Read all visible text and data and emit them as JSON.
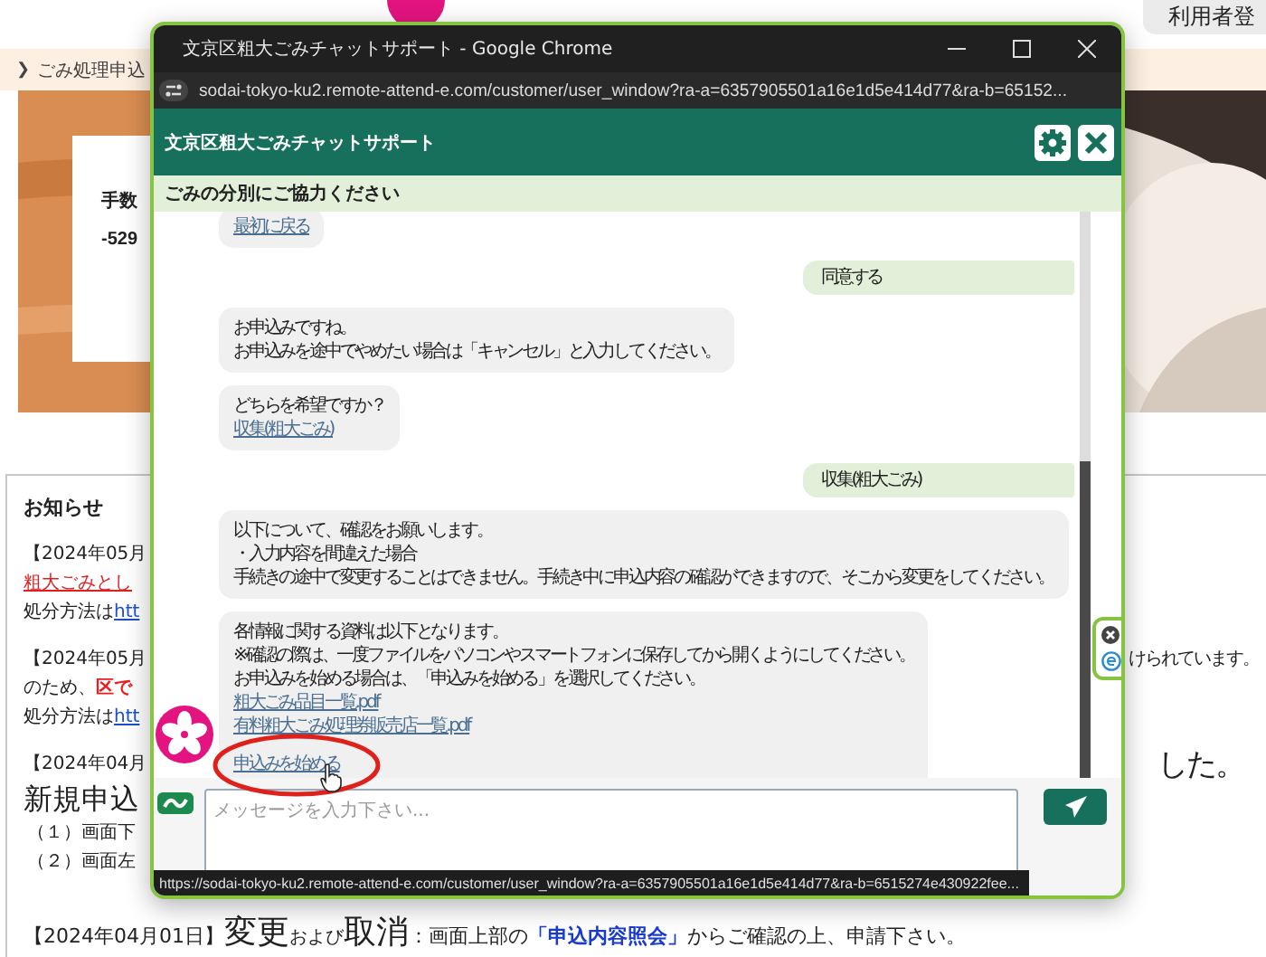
{
  "site": {
    "top_button": "利用者登",
    "breadcrumb": {
      "chevron": "❯",
      "label": "ごみ処理申込"
    },
    "hero_card": {
      "title": "手数",
      "code": "-529"
    }
  },
  "notices": {
    "title": "お知らせ",
    "rows": [
      {
        "kind": "date",
        "text": "【2024年05月"
      },
      {
        "kind": "redlink",
        "text": "粗大ごみとし"
      },
      {
        "kind": "method",
        "text": "処分方法は",
        "link": "htt"
      },
      {
        "kind": "date",
        "text": "【2024年05月",
        "right": "けられています。"
      },
      {
        "kind": "warning",
        "text": "のため、**区で**"
      },
      {
        "kind": "method",
        "text": "処分方法は",
        "link": "htt"
      },
      {
        "kind": "date",
        "text": "【2024年04月",
        "right": "した。"
      },
      {
        "kind": "large",
        "text": "新規申込"
      },
      {
        "kind": "plain",
        "text": "（１）画面下"
      },
      {
        "kind": "plain",
        "text": "（２）画面左"
      }
    ]
  },
  "footer_notice": {
    "segments": [
      {
        "kind": "plain",
        "text": "【2024年04月01日】"
      },
      {
        "kind": "large",
        "text": "変更"
      },
      {
        "kind": "small",
        "text": "および"
      },
      {
        "kind": "large",
        "text": "取消"
      },
      {
        "kind": "plain",
        "text": "：画面上部の"
      },
      {
        "kind": "link",
        "text": "「申込内容照会」"
      },
      {
        "kind": "plain",
        "text": "からご確認の上、申請下さい。"
      }
    ]
  },
  "chat_window": {
    "title": "文京区粗大ごみチャットサポート - Google Chrome",
    "url": "sodai-tokyo-ku2.remote-attend-e.com/customer/user_window?ra-a=6357905501a16e1d5e414d77&ra-b=65152...",
    "header": "文京区粗大ごみチャットサポート",
    "subheader": "ごみの分別にご協力ください",
    "messages": [
      {
        "kind": "bot",
        "links": [
          "最初に戻る"
        ]
      },
      {
        "kind": "user",
        "lines": [
          "同意する"
        ]
      },
      {
        "kind": "bot",
        "lines": [
          "お申込みですね。",
          "お申込みを途中でやめたい場合は「キャンセル」と入力してください。"
        ]
      },
      {
        "kind": "bot",
        "lines": [
          "どちらを希望ですか？"
        ],
        "links": [
          "収集(粗大ごみ)"
        ]
      },
      {
        "kind": "user",
        "lines": [
          "収集(粗大ごみ)"
        ]
      },
      {
        "kind": "bot",
        "lines": [
          "以下について、確認をお願いします。",
          "・入力内容を間違えた場合",
          "手続きの途中で変更することはできません。手続き中に申込内容の確認ができますので、そこから変更をしてください。"
        ]
      },
      {
        "kind": "bot",
        "lines": [
          "各情報に関する資料は以下となります。",
          "※確認の際は、一度ファイルをパソコンやスマートフォンに保存してから開くようにしてください。",
          "お申込みを始める場合は、「申込みを始める」を選択してください。"
        ],
        "links": [
          "粗大ごみ品目一覧.pdf",
          "有料粗大ごみ処理券販売店一覧.pdf"
        ],
        "action": "申込みを始める",
        "circled": true
      }
    ],
    "input": {
      "placeholder": "メッセージを入力下さい..."
    },
    "status_url": "https://sodai-tokyo-ku2.remote-attend-e.com/customer/user_window?ra-a=6357905501a16e1d5e414d77&ra-b=6515274e430922fee..."
  }
}
